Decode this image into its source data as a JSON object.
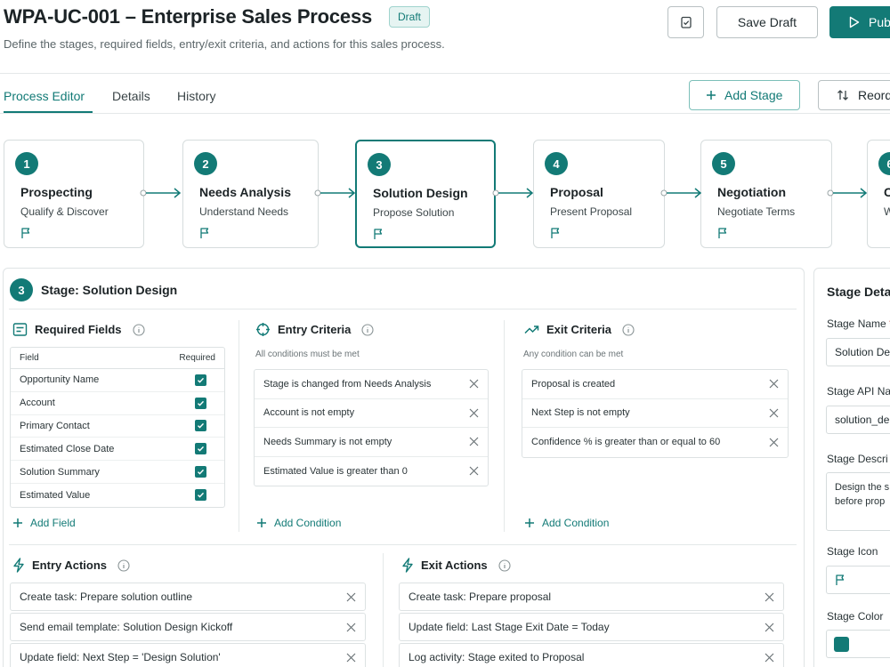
{
  "header": {
    "title": "WPA-UC-001 – Enterprise Sales Process",
    "badge": "Draft",
    "subtitle": "Define the stages, required fields, entry/exit criteria, and actions for this sales process.",
    "save_draft": "Save Draft",
    "publish": "Pub"
  },
  "tabs": {
    "process_editor": "Process Editor",
    "details": "Details",
    "history": "History",
    "add_stage": "Add Stage",
    "reorder": "Reord"
  },
  "stages": [
    {
      "num": "1",
      "name": "Prospecting",
      "sub": "Qualify & Discover"
    },
    {
      "num": "2",
      "name": "Needs Analysis",
      "sub": "Understand Needs"
    },
    {
      "num": "3",
      "name": "Solution Design",
      "sub": "Propose Solution"
    },
    {
      "num": "4",
      "name": "Proposal",
      "sub": "Present Proposal"
    },
    {
      "num": "5",
      "name": "Negotiation",
      "sub": "Negotiate Terms"
    },
    {
      "num": "6",
      "name": "C",
      "sub": "W"
    }
  ],
  "panel": {
    "num": "3",
    "title": "Stage: Solution Design",
    "required_fields": {
      "title": "Required Fields",
      "col_field": "Field",
      "col_required": "Required",
      "rows": [
        "Opportunity Name",
        "Account",
        "Primary Contact",
        "Estimated Close Date",
        "Solution Summary",
        "Estimated Value"
      ],
      "add": "Add Field"
    },
    "entry_criteria": {
      "title": "Entry Criteria",
      "note": "All conditions must be met",
      "rows": [
        "Stage is changed from Needs Analysis",
        "Account is not empty",
        "Needs Summary is not empty",
        "Estimated Value is greater than 0"
      ],
      "add": "Add Condition"
    },
    "exit_criteria": {
      "title": "Exit Criteria",
      "note": "Any condition can be met",
      "rows": [
        "Proposal is created",
        "Next Step is not empty",
        "Confidence % is greater than or equal to 60"
      ],
      "add": "Add Condition"
    },
    "entry_actions": {
      "title": "Entry Actions",
      "rows": [
        "Create task: Prepare solution outline",
        "Send email template: Solution Design Kickoff",
        "Update field: Next Step = 'Design Solution'"
      ]
    },
    "exit_actions": {
      "title": "Exit Actions",
      "rows": [
        "Create task: Prepare proposal",
        "Update field: Last Stage Exit Date = Today",
        "Log activity: Stage exited to Proposal"
      ]
    }
  },
  "details": {
    "title": "Stage Deta",
    "stage_name_label": "Stage Name",
    "stage_name_value": "Solution De",
    "api_label": "Stage API Na",
    "api_value": "solution_de",
    "desc_label": "Stage Descri",
    "desc_line1": "Design the s",
    "desc_line2": "before prop",
    "icon_label": "Stage Icon",
    "color_label": "Stage Color"
  },
  "colors": {
    "accent": "#137a76",
    "border": "#d6dcdd",
    "text": "#1c2326"
  }
}
